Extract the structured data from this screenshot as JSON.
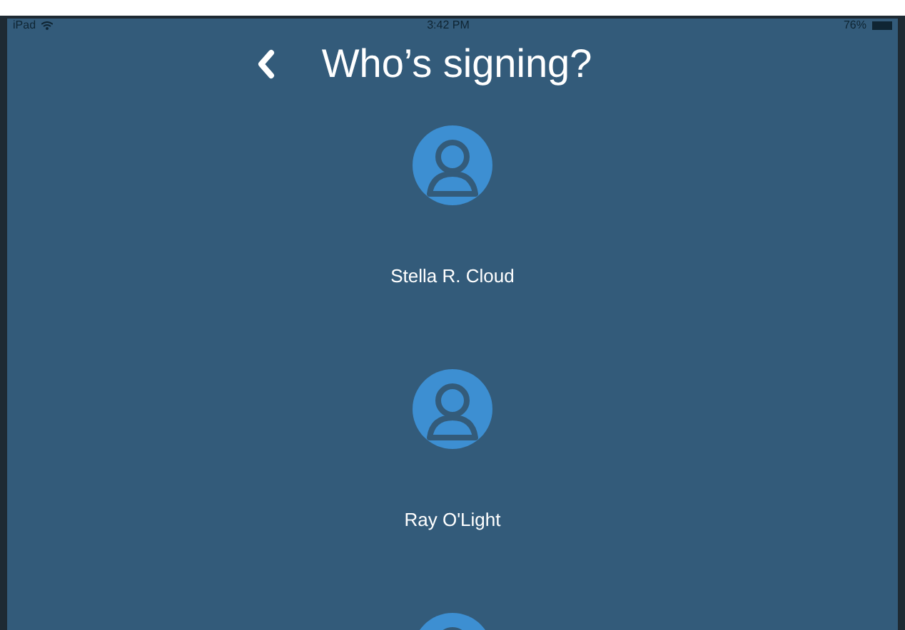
{
  "status_bar": {
    "device": "iPad",
    "time": "3:42 PM",
    "battery": "76%"
  },
  "header": {
    "title": "Who’s signing?"
  },
  "signers": [
    {
      "name": "Stella R. Cloud"
    },
    {
      "name": "Ray O'Light"
    }
  ],
  "more_below": true
}
